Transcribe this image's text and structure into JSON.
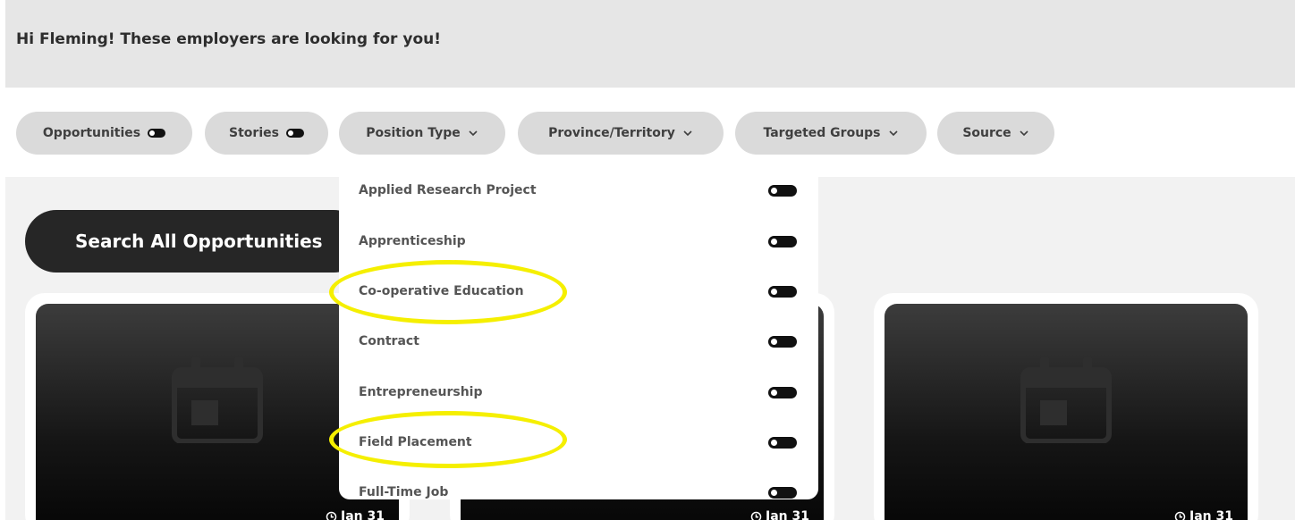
{
  "banner": {
    "greeting": "Hi Fleming! These employers are looking for you!"
  },
  "filters": {
    "opportunities_label": "Opportunities",
    "stories_label": "Stories",
    "position_type_label": "Position Type",
    "province_label": "Province/Territory",
    "targeted_groups_label": "Targeted Groups",
    "source_label": "Source"
  },
  "search": {
    "label": "Search All Opportunities"
  },
  "position_type_menu": {
    "items": [
      {
        "label": "Applied Research Project",
        "enabled": false
      },
      {
        "label": "Apprenticeship",
        "enabled": false
      },
      {
        "label": "Co-operative Education",
        "enabled": false
      },
      {
        "label": "Contract",
        "enabled": false
      },
      {
        "label": "Entrepreneurship",
        "enabled": false
      },
      {
        "label": "Field Placement",
        "enabled": false
      },
      {
        "label": "Full-Time Job",
        "enabled": false
      }
    ]
  },
  "cards": [
    {
      "date": "Jan 31",
      "icon": "calendar-icon"
    },
    {
      "date": "Jan 31",
      "icon": "calendar-icon"
    },
    {
      "date": "Jan 31",
      "icon": "calendar-icon"
    }
  ],
  "colors": {
    "highlight": "#f5ef00",
    "pill_bg": "#dadada",
    "dark": "#262626"
  }
}
